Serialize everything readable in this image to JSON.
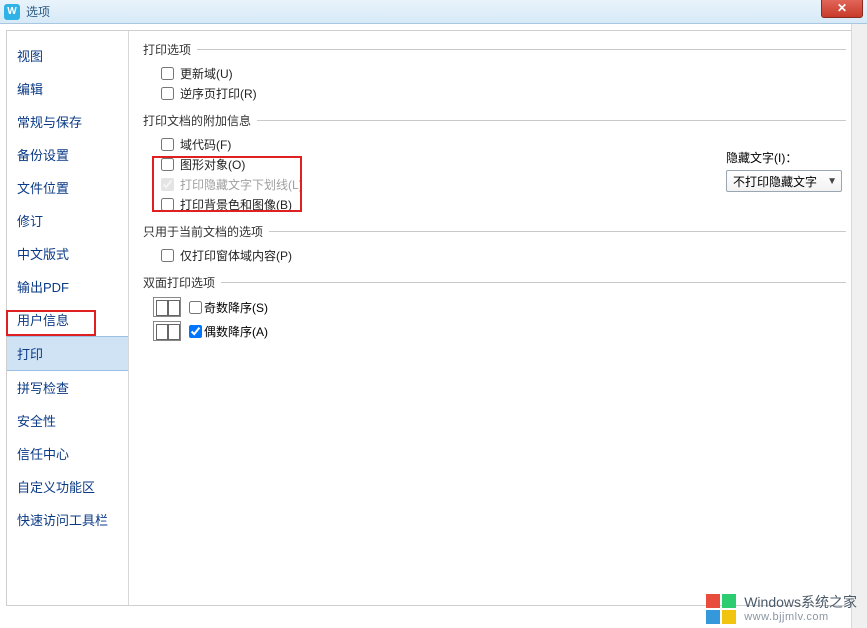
{
  "titlebar": {
    "title": "选项"
  },
  "sidebar": {
    "items": [
      {
        "label": "视图"
      },
      {
        "label": "编辑"
      },
      {
        "label": "常规与保存"
      },
      {
        "label": "备份设置"
      },
      {
        "label": "文件位置"
      },
      {
        "label": "修订"
      },
      {
        "label": "中文版式"
      },
      {
        "label": "输出PDF"
      },
      {
        "label": "用户信息"
      },
      {
        "label": "打印",
        "selected": true
      },
      {
        "label": "拼写检查"
      },
      {
        "label": "安全性"
      },
      {
        "label": "信任中心"
      },
      {
        "label": "自定义功能区"
      },
      {
        "label": "快速访问工具栏"
      }
    ]
  },
  "groups": {
    "print_options": {
      "title": "打印选项",
      "update_fields": "更新域(U)",
      "reverse_print": "逆序页打印(R)"
    },
    "attach_info": {
      "title": "打印文档的附加信息",
      "field_codes": "域代码(F)",
      "drawing_objects": "图形对象(O)",
      "hidden_underline": "打印隐藏文字下划线(L)",
      "background": "打印背景色和图像(B)",
      "hidden_text_label": "隐藏文字(I)：",
      "hidden_text_value": "不打印隐藏文字"
    },
    "current_doc": {
      "title": "只用于当前文档的选项",
      "form_fields_only": "仅打印窗体域内容(P)"
    },
    "duplex": {
      "title": "双面打印选项",
      "odd_desc": "奇数降序(S)",
      "even_desc": "偶数降序(A)"
    }
  },
  "watermark": {
    "line1": "Windows系统之家",
    "line2": "www.bjjmlv.com"
  }
}
